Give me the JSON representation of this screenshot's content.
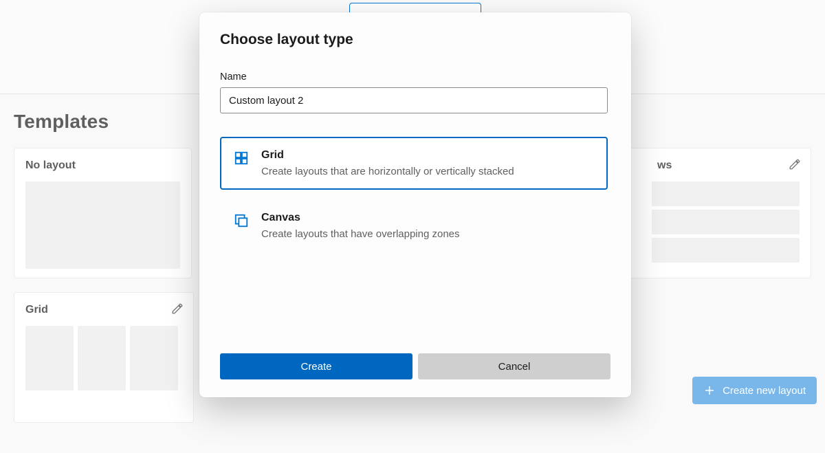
{
  "background": {
    "templates_heading": "Templates",
    "cards": {
      "no_layout": "No layout",
      "rows": "ws",
      "grid": "Grid"
    },
    "create_layout_label": "Create new layout"
  },
  "dialog": {
    "title": "Choose layout type",
    "name_label": "Name",
    "name_value": "Custom layout 2",
    "options": {
      "grid": {
        "title": "Grid",
        "desc": "Create layouts that are horizontally or vertically stacked",
        "icon": "grid-icon"
      },
      "canvas": {
        "title": "Canvas",
        "desc": "Create layouts that have overlapping zones",
        "icon": "canvas-icon"
      }
    },
    "selected": "grid",
    "buttons": {
      "create": "Create",
      "cancel": "Cancel"
    }
  },
  "colors": {
    "accent": "#0067c0"
  }
}
